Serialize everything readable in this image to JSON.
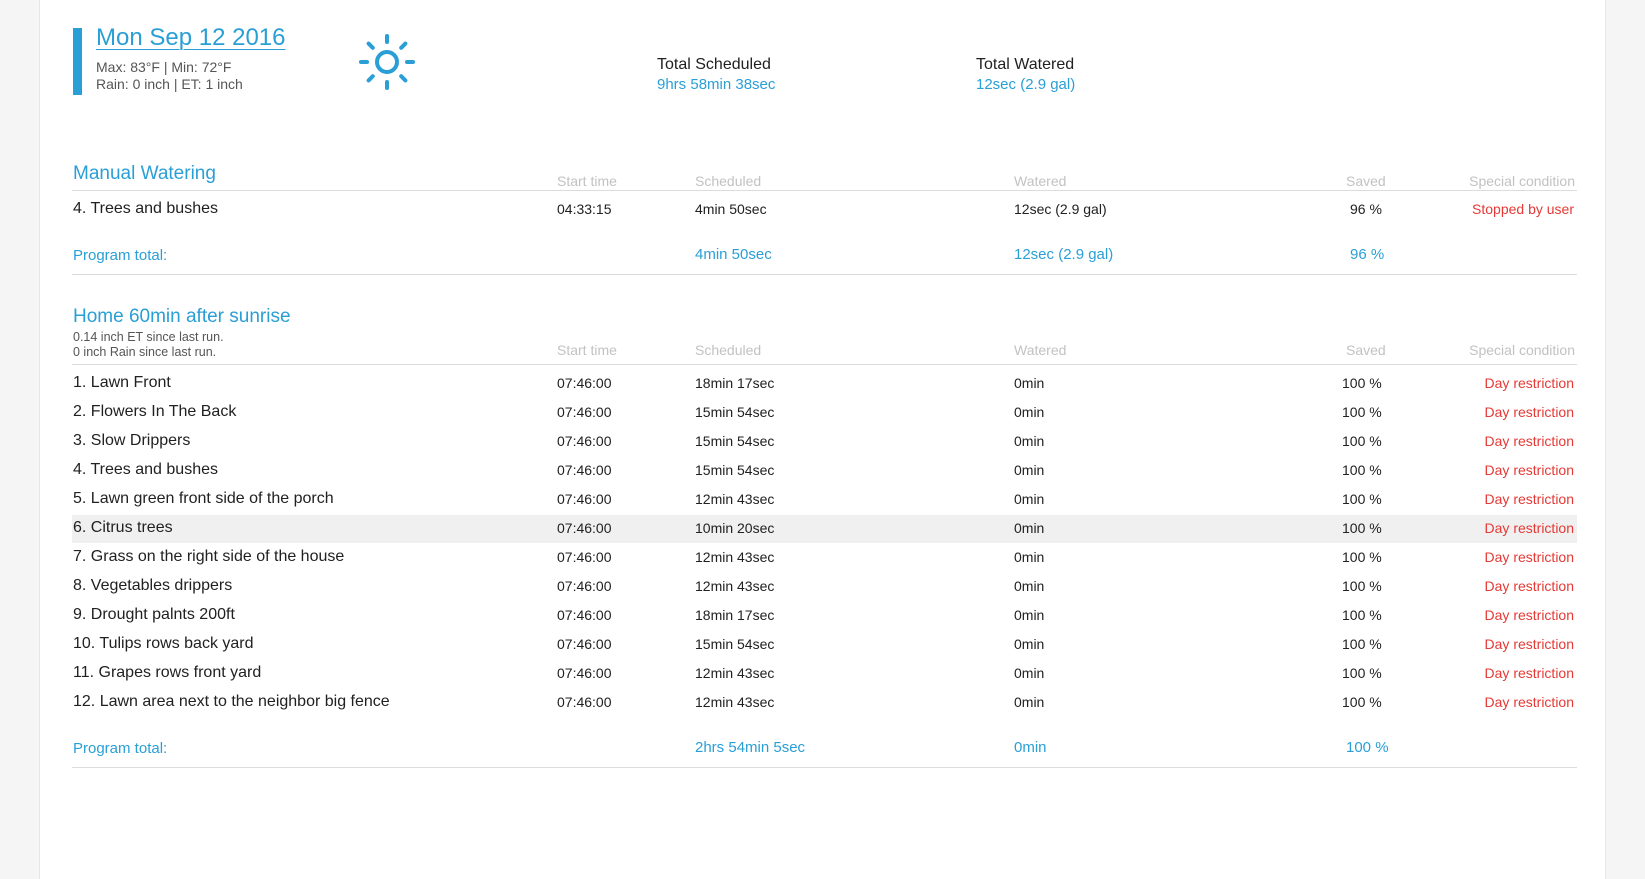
{
  "header": {
    "date": "Mon Sep 12 2016",
    "weather_line1": "Max: 83°F | Min: 72°F",
    "weather_line2": "Rain: 0 inch | ET: 1 inch",
    "weather_icon": "sun-icon",
    "total_scheduled_label": "Total Scheduled",
    "total_scheduled_value": "9hrs 58min 38sec",
    "total_watered_label": "Total Watered",
    "total_watered_value": "12sec (2.9 gal)"
  },
  "columns": {
    "start": "Start time",
    "scheduled": "Scheduled",
    "watered": "Watered",
    "saved": "Saved",
    "condition": "Special condition"
  },
  "colors": {
    "accent": "#2a9fd6",
    "alert": "#e53935"
  },
  "programs": [
    {
      "title": "Manual Watering",
      "rows": [
        {
          "name": "4. Trees and bushes",
          "start": "04:33:15",
          "scheduled": "4min 50sec",
          "watered": "12sec (2.9 gal)",
          "saved": "96 %",
          "condition": "Stopped by user"
        }
      ],
      "total_label": "Program total:",
      "total_scheduled": "4min 50sec",
      "total_watered": "12sec (2.9 gal)",
      "total_saved": "96 %"
    },
    {
      "title": "Home 60min after sunrise",
      "notes": [
        "0.14 inch ET since last run.",
        "0 inch Rain since last run."
      ],
      "rows": [
        {
          "name": "1. Lawn Front",
          "start": "07:46:00",
          "scheduled": "18min 17sec",
          "watered": "0min",
          "saved": "100 %",
          "condition": "Day restriction"
        },
        {
          "name": "2. Flowers In The Back",
          "start": "07:46:00",
          "scheduled": "15min 54sec",
          "watered": "0min",
          "saved": "100 %",
          "condition": "Day restriction"
        },
        {
          "name": "3. Slow Drippers",
          "start": "07:46:00",
          "scheduled": "15min 54sec",
          "watered": "0min",
          "saved": "100 %",
          "condition": "Day restriction"
        },
        {
          "name": "4. Trees and bushes",
          "start": "07:46:00",
          "scheduled": "15min 54sec",
          "watered": "0min",
          "saved": "100 %",
          "condition": "Day restriction"
        },
        {
          "name": "5. Lawn green front side of the porch",
          "start": "07:46:00",
          "scheduled": "12min 43sec",
          "watered": "0min",
          "saved": "100 %",
          "condition": "Day restriction"
        },
        {
          "name": "6. Citrus trees",
          "start": "07:46:00",
          "scheduled": "10min 20sec",
          "watered": "0min",
          "saved": "100 %",
          "condition": "Day restriction"
        },
        {
          "name": "7. Grass on the right side of the house",
          "start": "07:46:00",
          "scheduled": "12min 43sec",
          "watered": "0min",
          "saved": "100 %",
          "condition": "Day restriction"
        },
        {
          "name": "8. Vegetables drippers",
          "start": "07:46:00",
          "scheduled": "12min 43sec",
          "watered": "0min",
          "saved": "100 %",
          "condition": "Day restriction"
        },
        {
          "name": "9. Drought palnts 200ft",
          "start": "07:46:00",
          "scheduled": "18min 17sec",
          "watered": "0min",
          "saved": "100 %",
          "condition": "Day restriction"
        },
        {
          "name": "10. Tulips rows back yard",
          "start": "07:46:00",
          "scheduled": "15min 54sec",
          "watered": "0min",
          "saved": "100 %",
          "condition": "Day restriction"
        },
        {
          "name": "11. Grapes rows front yard",
          "start": "07:46:00",
          "scheduled": "12min 43sec",
          "watered": "0min",
          "saved": "100 %",
          "condition": "Day restriction"
        },
        {
          "name": "12. Lawn area next to the neighbor big fence",
          "start": "07:46:00",
          "scheduled": "12min 43sec",
          "watered": "0min",
          "saved": "100 %",
          "condition": "Day restriction"
        }
      ],
      "total_label": "Program total:",
      "total_scheduled": "2hrs 54min 5sec",
      "total_watered": "0min",
      "total_saved": "100 %"
    }
  ]
}
